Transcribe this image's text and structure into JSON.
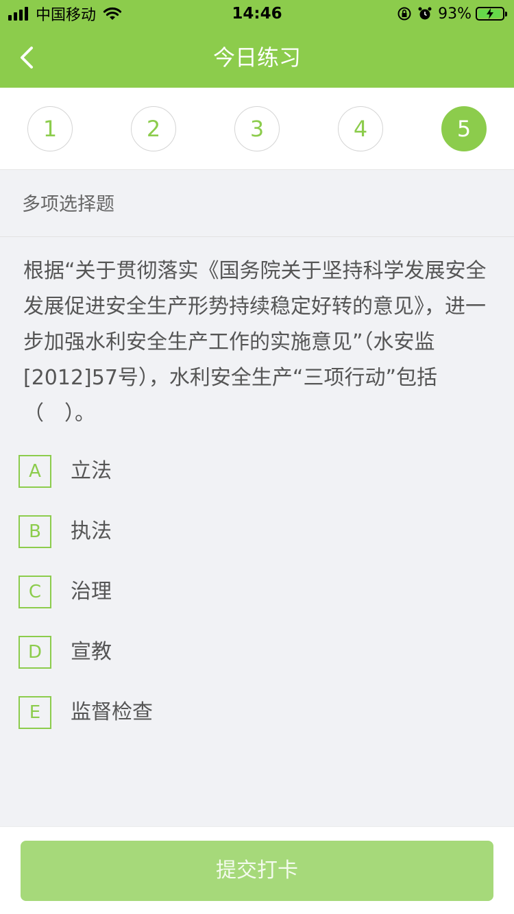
{
  "status_bar": {
    "carrier": "中国移动",
    "time": "14:46",
    "battery": "93%",
    "battery_level": 0.93
  },
  "nav": {
    "title": "今日练习",
    "back_icon": "chevron-left-icon"
  },
  "steps": [
    {
      "label": "1",
      "active": false
    },
    {
      "label": "2",
      "active": false
    },
    {
      "label": "3",
      "active": false
    },
    {
      "label": "4",
      "active": false
    },
    {
      "label": "5",
      "active": true
    }
  ],
  "question": {
    "type": "多项选择题",
    "text": "根据“关于贯彻落实《国务院关于坚持科学发展安全发展促进安全生产形势持续稳定好转的意见》，进一步加强水利安全生产工作的实施意见”（水安监[2012]57号），水利安全生产“三项行动”包括（　）。",
    "options": [
      {
        "letter": "A",
        "text": "立法"
      },
      {
        "letter": "B",
        "text": "执法"
      },
      {
        "letter": "C",
        "text": "治理"
      },
      {
        "letter": "D",
        "text": "宣教"
      },
      {
        "letter": "E",
        "text": "监督检查"
      }
    ]
  },
  "submit": {
    "label": "提交打卡"
  },
  "colors": {
    "accent": "#8ccc4c",
    "button_disabled": "#a6d97a",
    "background": "#f1f2f5"
  }
}
